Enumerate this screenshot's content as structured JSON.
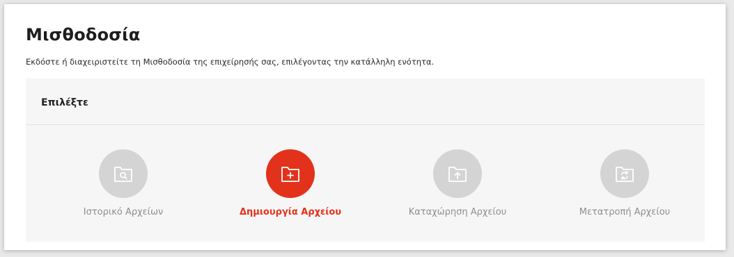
{
  "header": {
    "title": "Μισθοδοσία",
    "subtitle": "Εκδόστε ή διαχειριστείτε τη Μισθοδοσία της επιχείρησής σας, επιλέγοντας την κατάλληλη ενότητα."
  },
  "panel": {
    "title": "Επιλέξτε",
    "options": [
      {
        "label": "Ιστορικό Αρχείων",
        "icon": "folder-search-icon",
        "active": false
      },
      {
        "label": "Δημιουργία Αρχείου",
        "icon": "folder-add-icon",
        "active": true
      },
      {
        "label": "Καταχώρηση Αρχείου",
        "icon": "folder-upload-icon",
        "active": false
      },
      {
        "label": "Μετατροπή Αρχείου",
        "icon": "folder-convert-icon",
        "active": false
      }
    ]
  },
  "colors": {
    "accent": "#e3321b",
    "inactive_circle": "#d4d4d4",
    "inactive_text": "#8e8e8e",
    "panel_bg": "#f6f6f6"
  }
}
